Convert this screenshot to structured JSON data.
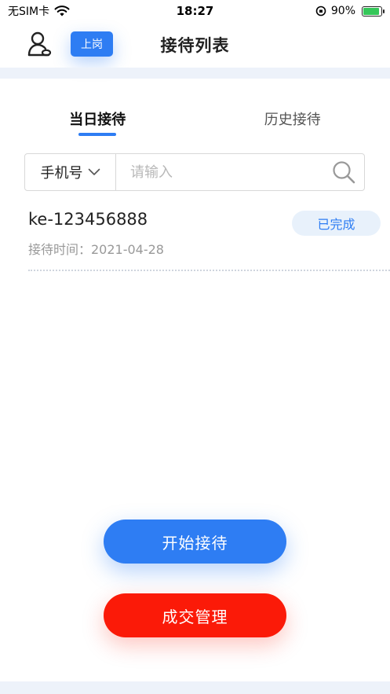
{
  "status_bar": {
    "carrier": "无SIM卡",
    "time": "18:27",
    "battery": "90%",
    "battery_level": 0.9
  },
  "nav": {
    "on_duty_label": "上岗",
    "title": "接待列表"
  },
  "tabs": [
    {
      "label": "当日接待",
      "active": true
    },
    {
      "label": "历史接待",
      "active": false
    }
  ],
  "search": {
    "filter_value": "手机号",
    "placeholder": "请输入"
  },
  "list": [
    {
      "code": "ke-123456888",
      "time": "接待时间：2021-04-28",
      "status": "已完成"
    }
  ],
  "buttons": {
    "start": "开始接待",
    "deal": "成交管理"
  },
  "colors": {
    "primary": "#2e7df3",
    "danger": "#fb1a08"
  }
}
